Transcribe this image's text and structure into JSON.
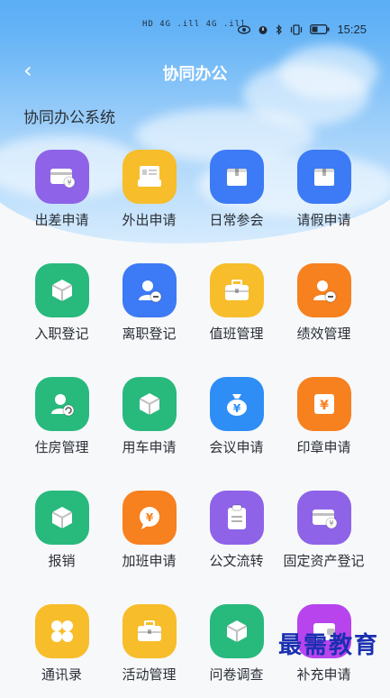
{
  "status": {
    "left_text": "HD 4G .ill 4G .ill",
    "time": "15:25"
  },
  "nav": {
    "title": "协同办公",
    "back": "‹"
  },
  "section": {
    "title": "协同办公系统"
  },
  "apps": [
    {
      "label": "出差申请",
      "icon": "card-icon",
      "color": "#8e63e8"
    },
    {
      "label": "外出申请",
      "icon": "id-card-icon",
      "color": "#f7bd2a"
    },
    {
      "label": "日常参会",
      "icon": "box-icon",
      "color": "#3d7af5"
    },
    {
      "label": "请假申请",
      "icon": "box-icon",
      "color": "#3d7af5"
    },
    {
      "label": "入职登记",
      "icon": "cube-icon",
      "color": "#28b97d"
    },
    {
      "label": "离职登记",
      "icon": "user-minus-icon",
      "color": "#3d7af5"
    },
    {
      "label": "值班管理",
      "icon": "briefcase-icon",
      "color": "#f7bd2a"
    },
    {
      "label": "绩效管理",
      "icon": "user-minus-icon",
      "color": "#f7801f"
    },
    {
      "label": "住房管理",
      "icon": "user-refresh-icon",
      "color": "#28b97d"
    },
    {
      "label": "用车申请",
      "icon": "cube-icon",
      "color": "#28b97d"
    },
    {
      "label": "会议申请",
      "icon": "money-bag-icon",
      "color": "#2e8ef5"
    },
    {
      "label": "印章申请",
      "icon": "yen-box-icon",
      "color": "#f7801f"
    },
    {
      "label": "报销",
      "icon": "cube-icon",
      "color": "#28b97d"
    },
    {
      "label": "加班申请",
      "icon": "yen-chat-icon",
      "color": "#f7801f"
    },
    {
      "label": "公文流转",
      "icon": "clipboard-icon",
      "color": "#8e63e8"
    },
    {
      "label": "固定资产登记",
      "icon": "card-icon",
      "color": "#8e63e8"
    },
    {
      "label": "通讯录",
      "icon": "grid-icon",
      "color": "#f7bd2a"
    },
    {
      "label": "活动管理",
      "icon": "briefcase-icon",
      "color": "#f7bd2a"
    },
    {
      "label": "问卷调查",
      "icon": "cube-icon",
      "color": "#28b97d"
    },
    {
      "label": "补充申请",
      "icon": "wallet-icon",
      "color": "#b844ee"
    }
  ],
  "watermark": "最需教育"
}
